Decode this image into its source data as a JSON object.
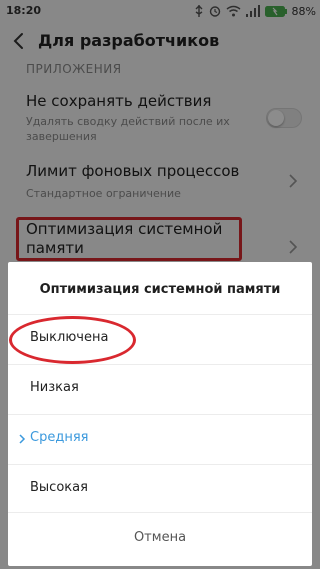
{
  "status_bar": {
    "time": "18:20",
    "battery_pct": "88%",
    "icons": [
      "usb-icon",
      "alarm-icon",
      "wifi-icon",
      "signal-icon",
      "battery-icon"
    ]
  },
  "header": {
    "title": "Для разработчиков",
    "back_icon": "chevron-left-icon"
  },
  "settings": {
    "section_label": "ПРИЛОЖЕНИЯ",
    "items": [
      {
        "title": "Не сохранять действия",
        "subtitle": "Удалять сводку действий после их завершения",
        "control": "toggle-off"
      },
      {
        "title": "Лимит фоновых процессов",
        "subtitle": "Стандартное ограничение",
        "control": "chevron"
      },
      {
        "title": "Оптимизация системной памяти",
        "subtitle": "",
        "control": "chevron"
      }
    ]
  },
  "dialog": {
    "title": "Оптимизация системной памяти",
    "options": [
      {
        "label": "Выключена",
        "selected": false
      },
      {
        "label": "Низкая",
        "selected": false
      },
      {
        "label": "Средняя",
        "selected": true
      },
      {
        "label": "Высокая",
        "selected": false
      }
    ],
    "cancel_label": "Отмена"
  },
  "colors": {
    "accent": "#3b99dd",
    "highlight_annotation": "#d9282f",
    "background": "#f7f7f7"
  }
}
